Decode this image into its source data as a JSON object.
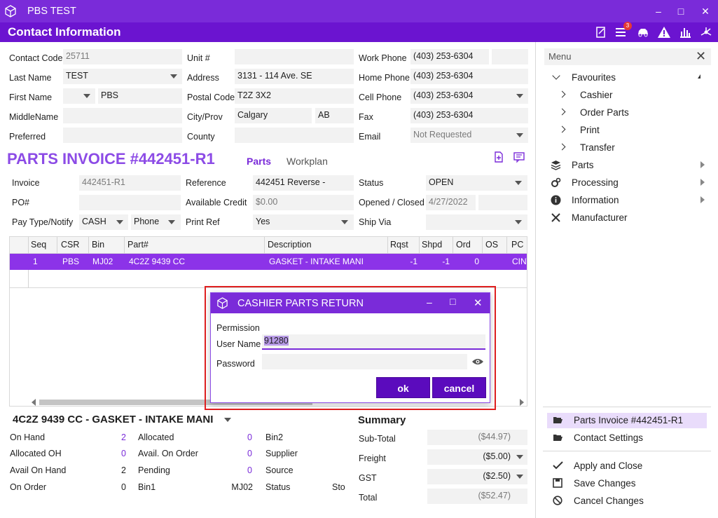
{
  "window": {
    "title": "PBS TEST"
  },
  "header": {
    "title": "Contact Information",
    "badge_count": "3"
  },
  "contact": {
    "contact_code_label": "Contact Code",
    "contact_code": "25711",
    "last_name_label": "Last Name",
    "last_name": "TEST",
    "first_name_label": "First Name",
    "first_name": "PBS",
    "middle_name_label": "MiddleName",
    "middle_name": "",
    "preferred_label": "Preferred",
    "preferred": "",
    "unit_label": "Unit #",
    "unit": "",
    "address_label": "Address",
    "address": "3131 - 114 Ave. SE",
    "postal_label": "Postal Code",
    "postal": "T2Z 3X2",
    "city_label": "City/Prov",
    "city": "Calgary",
    "prov": "AB",
    "county_label": "County",
    "county": "",
    "work_phone_label": "Work Phone",
    "work_phone": "(403) 253-6304",
    "work_ext": "",
    "home_phone_label": "Home Phone",
    "home_phone": "(403) 253-6304",
    "cell_phone_label": "Cell Phone",
    "cell_phone": "(403) 253-6304",
    "fax_label": "Fax",
    "fax": "(403) 253-6304",
    "email_label": "Email",
    "email": "Not Requested"
  },
  "invoice": {
    "title": "PARTS INVOICE #442451-R1",
    "tab_parts": "Parts",
    "tab_workplan": "Workplan",
    "invoice_label": "Invoice",
    "invoice": "442451-R1",
    "po_label": "PO#",
    "po": "",
    "paytype_label": "Pay Type/Notify",
    "paytype": "CASH",
    "notify": "Phone",
    "reference_label": "Reference",
    "reference": "442451 Reverse -",
    "credit_label": "Available Credit",
    "credit": "$0.00",
    "printref_label": "Print Ref",
    "printref": "Yes",
    "status_label": "Status",
    "status": "OPEN",
    "opened_label": "Opened / Closed",
    "opened": "4/27/2022",
    "closed": "",
    "shipvia_label": "Ship Via",
    "shipvia": ""
  },
  "grid": {
    "columns": [
      "Seq",
      "CSR",
      "Bin",
      "Part#",
      "Description",
      "Rqst",
      "Shpd",
      "Ord",
      "OS",
      "PC"
    ],
    "rows": [
      {
        "seq": "1",
        "csr": "PBS",
        "bin": "MJ02",
        "part": "4C2Z 9439 CC",
        "desc": "GASKET - INTAKE MANI",
        "rqst": "-1",
        "shpd": "-1",
        "ord": "0",
        "os": "",
        "pc": "CINV"
      }
    ]
  },
  "part_detail": {
    "title": "4C2Z 9439 CC - GASKET - INTAKE MANI",
    "on_hand_label": "On Hand",
    "on_hand": "2",
    "allocated_oh_label": "Allocated OH",
    "allocated_oh": "0",
    "avail_on_hand_label": "Avail On Hand",
    "avail_on_hand": "2",
    "on_order_label": "On Order",
    "on_order": "0",
    "allocated_label": "Allocated",
    "allocated": "0",
    "avail_on_order_label": "Avail. On Order",
    "avail_on_order": "0",
    "pending_label": "Pending",
    "pending": "0",
    "bin1_label": "Bin1",
    "bin1": "MJ02",
    "bin2_label": "Bin2",
    "supplier_label": "Supplier",
    "source_label": "Source",
    "status_label": "Status",
    "status": "Sto"
  },
  "summary": {
    "title": "Summary",
    "subtotal_label": "Sub-Total",
    "subtotal": "($44.97)",
    "freight_label": "Freight",
    "freight": "($5.00)",
    "gst_label": "GST",
    "gst": "($2.50)",
    "total_label": "Total",
    "total": "($52.47)"
  },
  "menu": {
    "placeholder": "Menu",
    "favourites": "Favourites",
    "fav_items": [
      "Cashier",
      "Order Parts",
      "Print",
      "Transfer"
    ],
    "parts": "Parts",
    "processing": "Processing",
    "information": "Information",
    "manufacturer": "Manufacturer",
    "open_docs": [
      "Parts Invoice #442451-R1",
      "Contact Settings"
    ],
    "actions": [
      "Apply and Close",
      "Save Changes",
      "Cancel Changes"
    ]
  },
  "dialog": {
    "title": "CASHIER PARTS RETURN",
    "permission_label": "Permission",
    "username_label": "User Name",
    "username": "91280",
    "password_label": "Password",
    "password": "",
    "ok": "ok",
    "cancel": "cancel"
  },
  "colors": {
    "accent": "#7a2bd9",
    "header": "#6b14d0",
    "selected_row": "#8c33e8",
    "button": "#5b0bbd",
    "highlight_outline": "#e02020"
  }
}
